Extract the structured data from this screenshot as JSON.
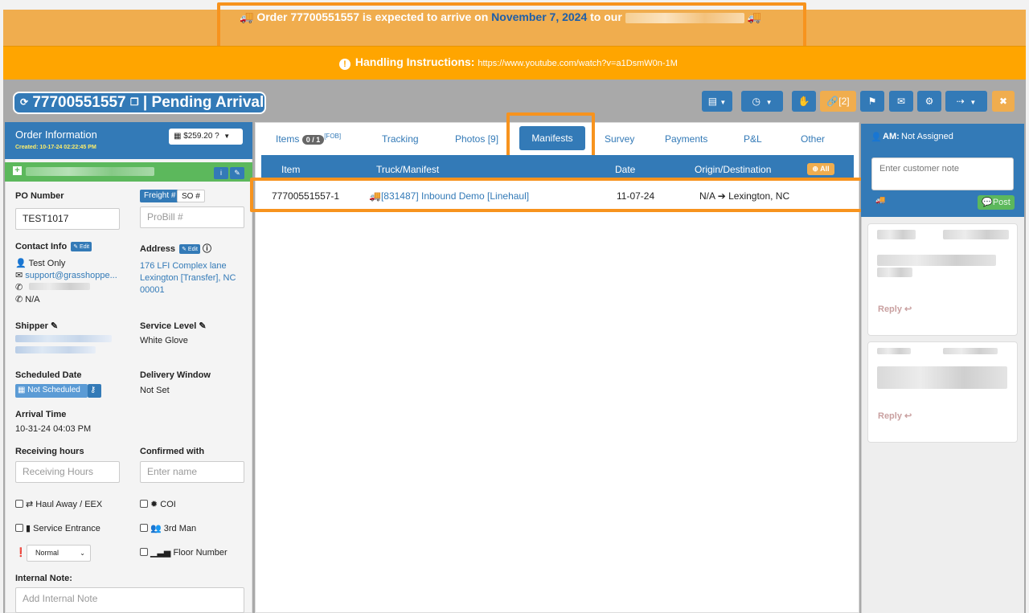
{
  "banner": {
    "prefix": "Order 77700551557 is expected to arrive on ",
    "date": "November 7, 2024",
    "suffix": " to our "
  },
  "handling": {
    "label": "Handling Instructions:",
    "url": "https://www.youtube.com/watch?v=a1DsmW0n-1M"
  },
  "order": {
    "number": "77700551557",
    "status": "| Pending Arrival"
  },
  "toolbar": {
    "links_label": "[2]"
  },
  "order_info": {
    "title": "Order Information",
    "created": "Created: 10-17-24 02:22:45 PM",
    "price": "$259.20",
    "po_label": "PO Number",
    "po_value": "TEST1017",
    "freight_tag": "Freight #",
    "so_tag": "SO #",
    "probill_placeholder": "ProBill #",
    "contact_label": "Contact Info",
    "edit_label": "Edit",
    "contact_name": "Test Only",
    "contact_email": "support@grasshoppe...",
    "contact_alt_phone": "N/A",
    "address_label": "Address",
    "address_line1": "176 LFI Complex lane",
    "address_line2": "Lexington [Transfer], NC",
    "address_line3": "00001",
    "shipper_label": "Shipper",
    "service_level_label": "Service Level",
    "service_level_value": "White Glove",
    "scheduled_label": "Scheduled Date",
    "scheduled_value": "Not Scheduled",
    "delivery_window_label": "Delivery Window",
    "delivery_window_value": "Not Set",
    "arrival_label": "Arrival Time",
    "arrival_value": "10-31-24 04:03 PM",
    "receiving_label": "Receiving hours",
    "receiving_placeholder": "Receiving Hours",
    "confirmed_label": "Confirmed with",
    "confirmed_placeholder": "Enter name",
    "haul_away": "Haul Away / EEX",
    "coi": "COI",
    "service_entrance": "Service Entrance",
    "third_man": "3rd Man",
    "priority": "Normal",
    "floor_number": "Floor Number",
    "internal_note_label": "Internal Note:",
    "internal_note_placeholder": "Add Internal Note"
  },
  "tabs": {
    "items": "Items",
    "items_badge": "0 / 1",
    "items_sup": "[FOB]",
    "tracking": "Tracking",
    "photos": "Photos [9]",
    "manifests": "Manifests",
    "survey": "Survey",
    "payments": "Payments",
    "pl": "P&L",
    "other": "Other"
  },
  "manifest_table": {
    "headers": [
      "Item",
      "Truck/Manifest",
      "Date",
      "Origin/Destination"
    ],
    "all_label": "All",
    "rows": [
      {
        "item": "77700551557-1",
        "manifest": "[831487] Inbound Demo [Linehaul]",
        "date": "11-07-24",
        "origin": "N/A",
        "destination": "Lexington, NC"
      }
    ]
  },
  "right_panel": {
    "am_label": "AM:",
    "am_value": "Not Assigned",
    "note_placeholder": "Enter customer note",
    "post_label": "Post",
    "reply_label": "Reply"
  }
}
